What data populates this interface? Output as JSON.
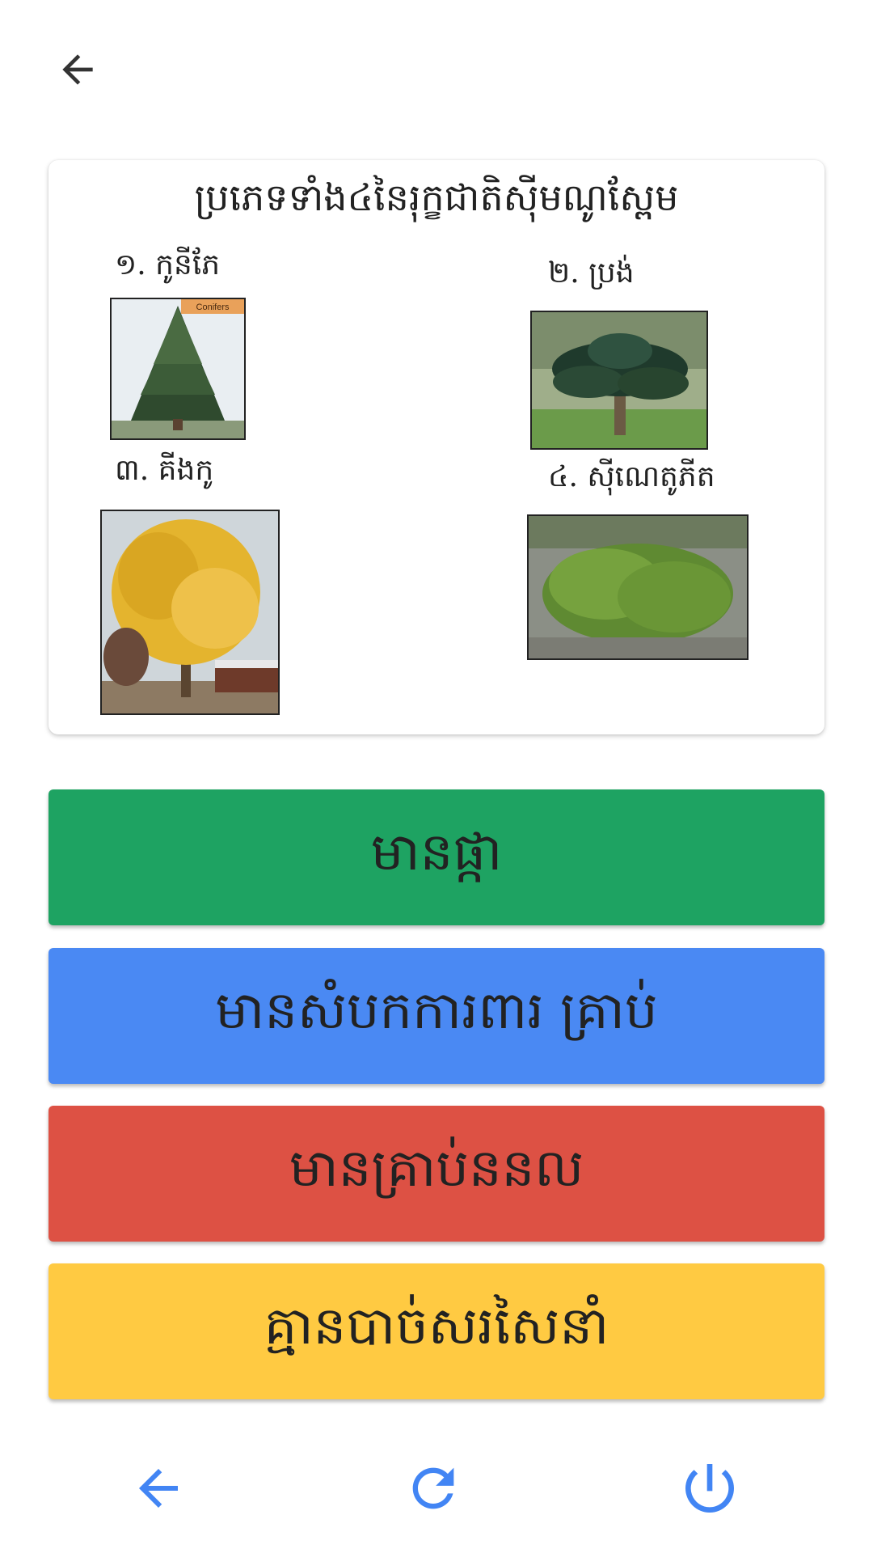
{
  "card": {
    "title": "ប្រភេទទាំង៤នៃរុក្ខជាតិស៊ីមណូស្ពែម",
    "items": [
      {
        "label": "១. កូនីភែ",
        "image_tag": "Conifers"
      },
      {
        "label": "២. ប្រង់"
      },
      {
        "label": "៣. គីងកូ"
      },
      {
        "label": "៤. ស៊ីណេតូភីត"
      }
    ]
  },
  "answers": [
    {
      "label": "មានផ្កា",
      "color": "#1EA362"
    },
    {
      "label": "មានសំបកការពារ គ្រាប់",
      "color": "#4A89F3"
    },
    {
      "label": "មានគ្រាប់ននល",
      "color": "#DD5144"
    },
    {
      "label": "គ្មានបាច់សរសៃនាំ",
      "color": "#FFCA42"
    }
  ],
  "nav": {
    "icon_color": "#4285F4",
    "top_back_icon": "arrow-back-icon",
    "back_icon": "arrow-back-icon",
    "refresh_icon": "refresh-icon",
    "power_icon": "power-icon"
  }
}
